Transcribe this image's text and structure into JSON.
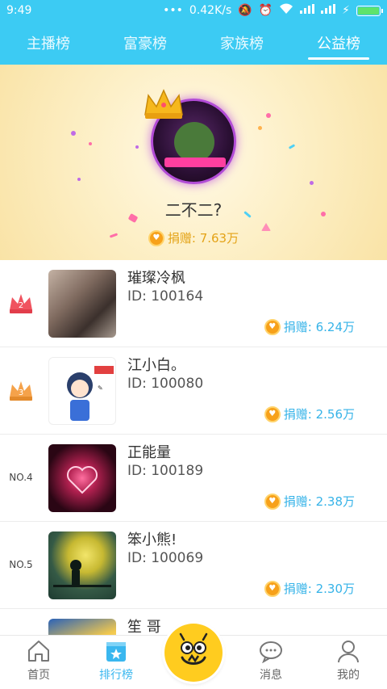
{
  "status_bar": {
    "time": "9:49",
    "net_speed": "0.42K/s"
  },
  "tabs": [
    {
      "label": "主播榜",
      "active": false
    },
    {
      "label": "富豪榜",
      "active": false
    },
    {
      "label": "家族榜",
      "active": false
    },
    {
      "label": "公益榜",
      "active": true
    }
  ],
  "top_donor": {
    "name": "二不二?",
    "donation": "捐赠: 7.63万"
  },
  "ranking": [
    {
      "rank_badge": "2",
      "name": "璀璨冷枫",
      "id": "ID: 100164",
      "donation": "捐赠: 6.24万"
    },
    {
      "rank_badge": "3",
      "name": "江小白。",
      "id": "ID: 100080",
      "donation": "捐赠: 2.56万"
    },
    {
      "rank_label": "NO.4",
      "name": "正能量",
      "id": "ID: 100189",
      "donation": "捐赠: 2.38万"
    },
    {
      "rank_label": "NO.5",
      "name": "笨小熊!",
      "id": "ID: 100069",
      "donation": "捐赠: 2.30万"
    },
    {
      "name": "笙 哥"
    }
  ],
  "bottom_nav": [
    {
      "label": "首页",
      "icon": "home-icon",
      "active": false
    },
    {
      "label": "排行榜",
      "icon": "ranking-icon",
      "active": true
    },
    {
      "label": "消息",
      "icon": "message-icon",
      "active": false
    },
    {
      "label": "我的",
      "icon": "profile-icon",
      "active": false
    }
  ],
  "colors": {
    "header": "#3ccbf3",
    "accent": "#3ab7ef",
    "gold": "#e4a317",
    "center_button": "#ffcc1f"
  }
}
